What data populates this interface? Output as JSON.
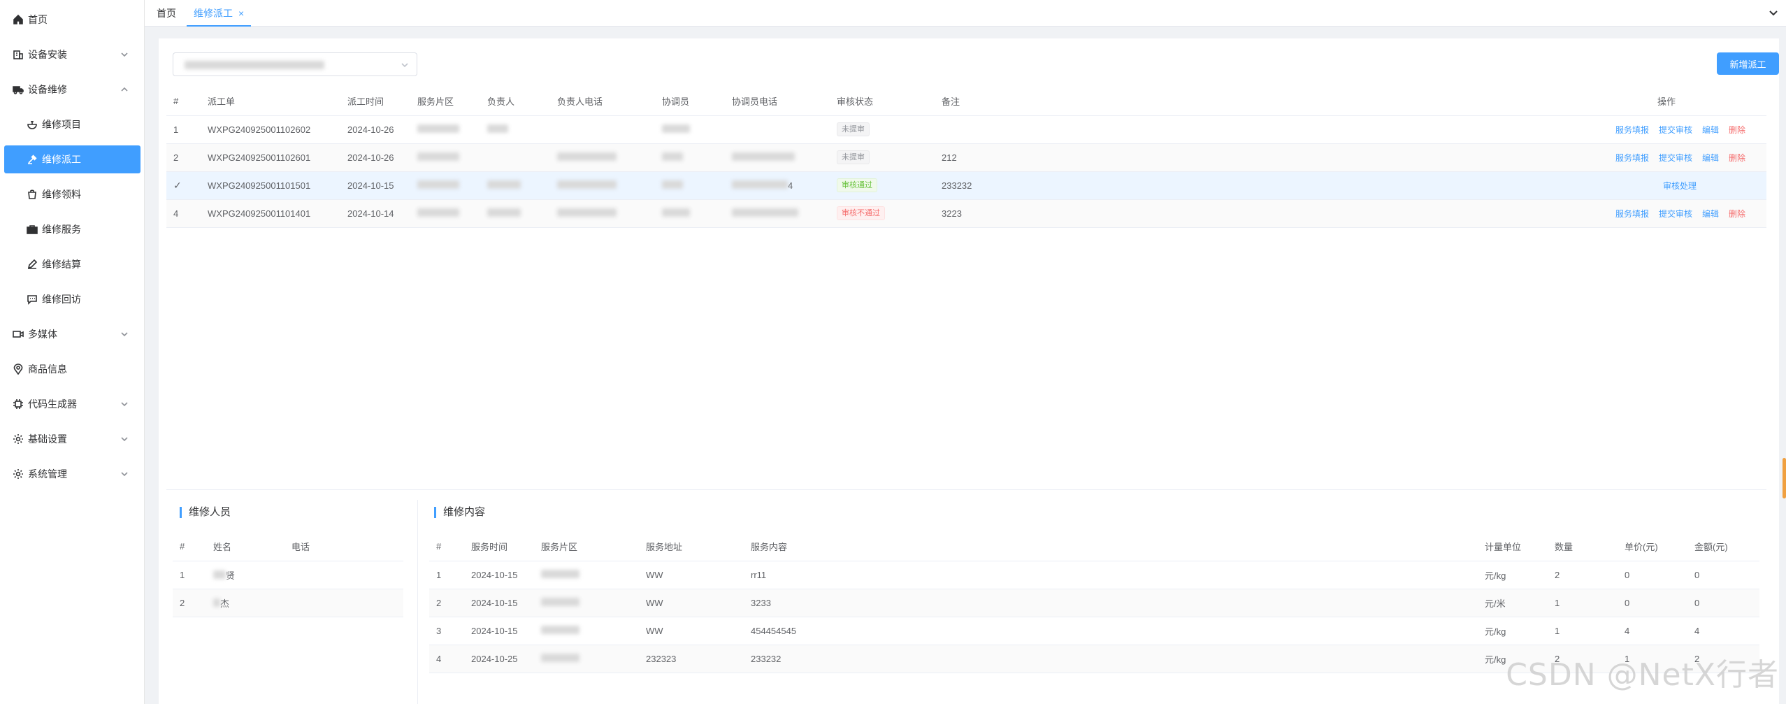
{
  "sidebar": {
    "items": [
      {
        "label": "首页",
        "icon": "home-icon"
      },
      {
        "label": "设备安装",
        "icon": "building-icon"
      },
      {
        "label": "设备维修",
        "icon": "truck-icon"
      },
      {
        "label": "维修项目",
        "icon": "bowl-icon"
      },
      {
        "label": "维修派工",
        "icon": "gavel-icon"
      },
      {
        "label": "维修领料",
        "icon": "bag-icon"
      },
      {
        "label": "维修服务",
        "icon": "briefcase-icon"
      },
      {
        "label": "维修结算",
        "icon": "pen-icon"
      },
      {
        "label": "维修回访",
        "icon": "chat-icon"
      },
      {
        "label": "多媒体",
        "icon": "video-icon"
      },
      {
        "label": "商品信息",
        "icon": "location-icon"
      },
      {
        "label": "代码生成器",
        "icon": "chip-icon"
      },
      {
        "label": "基础设置",
        "icon": "settings-icon"
      },
      {
        "label": "系统管理",
        "icon": "settings-icon"
      }
    ]
  },
  "tabs": {
    "home": "首页",
    "active": "维修派工",
    "close": "×"
  },
  "toolbar": {
    "add_label": "新增派工"
  },
  "main_table": {
    "headers": [
      "#",
      "派工单",
      "派工时间",
      "服务片区",
      "负责人",
      "负责人电话",
      "协调员",
      "协调员电话",
      "审核状态",
      "备注",
      "操作"
    ],
    "rows": [
      {
        "idx": "1",
        "order": "WXPG240925001102602",
        "time": "2024-10-26",
        "status": "未提审",
        "remark": ""
      },
      {
        "idx": "2",
        "order": "WXPG240925001102601",
        "time": "2024-10-26",
        "status": "未提审",
        "remark": "212"
      },
      {
        "idx": "✓",
        "order": "WXPG240925001101501",
        "time": "2024-10-15",
        "status": "审核通过",
        "remark": "233232"
      },
      {
        "idx": "4",
        "order": "WXPG240925001101401",
        "time": "2024-10-14",
        "status": "审核不通过",
        "remark": "3223"
      }
    ],
    "row3_phone_suffix": "4",
    "ops": {
      "fill": "服务填报",
      "submit": "提交审核",
      "edit": "编辑",
      "delete": "删除",
      "review": "审核处理"
    }
  },
  "staff": {
    "title": "维修人员",
    "headers": [
      "#",
      "姓名",
      "电话"
    ],
    "rows": [
      {
        "idx": "1",
        "name_tail": "贤"
      },
      {
        "idx": "2",
        "name_tail": "杰"
      }
    ]
  },
  "content": {
    "title": "维修内容",
    "headers": [
      "#",
      "服务时间",
      "服务片区",
      "服务地址",
      "服务内容",
      "计量单位",
      "数量",
      "单价(元)",
      "金额(元)"
    ],
    "rows": [
      {
        "idx": "1",
        "time": "2024-10-15",
        "addr": "WW",
        "content": "rr11",
        "unit": "元/kg",
        "qty": "2",
        "price": "0",
        "amount": "0"
      },
      {
        "idx": "2",
        "time": "2024-10-15",
        "addr": "WW",
        "content": "3233",
        "unit": "元/米",
        "qty": "1",
        "price": "0",
        "amount": "0"
      },
      {
        "idx": "3",
        "time": "2024-10-15",
        "addr": "WW",
        "content": "454454545",
        "unit": "元/kg",
        "qty": "1",
        "price": "4",
        "amount": "4"
      },
      {
        "idx": "4",
        "time": "2024-10-25",
        "addr": "232323",
        "content": "233232",
        "unit": "元/kg",
        "qty": "2",
        "price": "1",
        "amount": "2"
      }
    ]
  },
  "watermark": "CSDN @NetX行者",
  "colors": {
    "accent": "#409eff",
    "success": "#67c23a",
    "danger": "#f56c6c"
  }
}
